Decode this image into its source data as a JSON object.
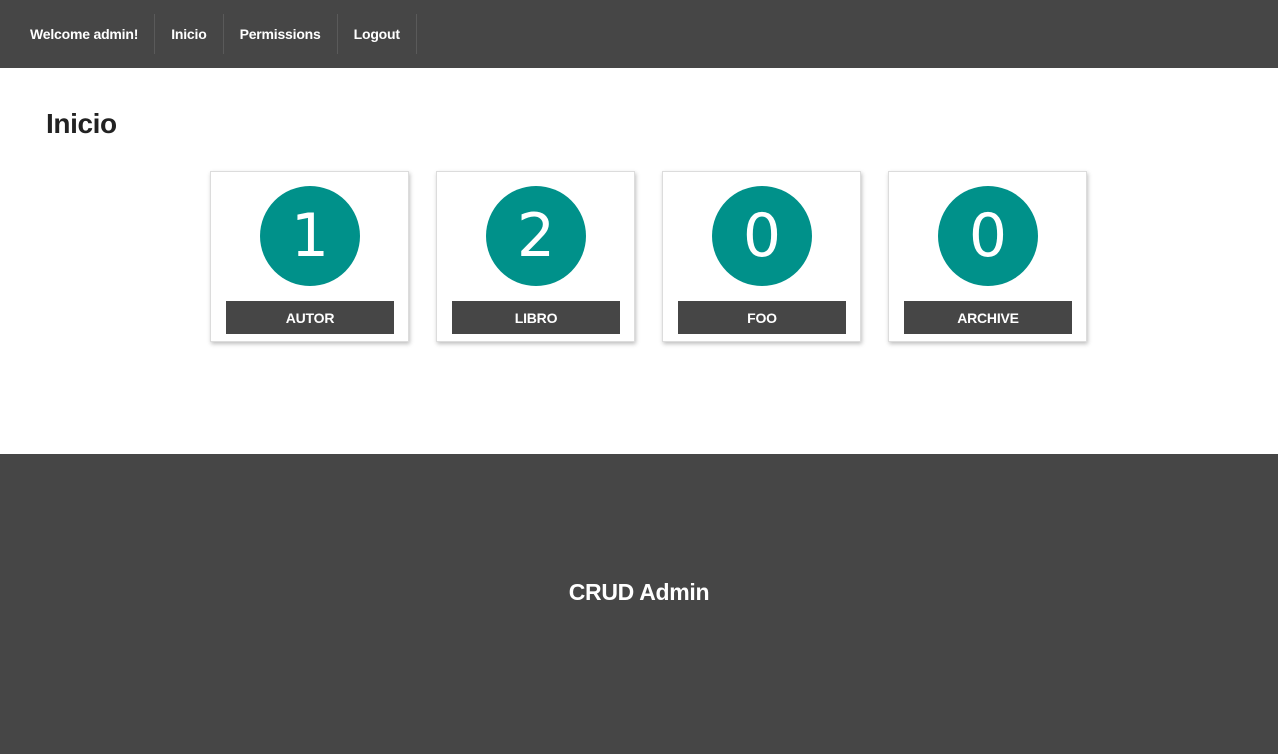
{
  "nav": {
    "items": [
      {
        "label": "Welcome admin!"
      },
      {
        "label": "Inicio"
      },
      {
        "label": "Permissions"
      },
      {
        "label": "Logout"
      }
    ]
  },
  "main": {
    "title": "Inicio",
    "cards": [
      {
        "count": "1",
        "label": "AUTOR"
      },
      {
        "count": "2",
        "label": "LIBRO"
      },
      {
        "count": "0",
        "label": "FOO"
      },
      {
        "count": "0",
        "label": "ARCHIVE"
      }
    ]
  },
  "footer": {
    "title": "CRUD Admin"
  },
  "colors": {
    "bar": "#464646",
    "accent": "#00918a",
    "background": "#ffffff"
  }
}
